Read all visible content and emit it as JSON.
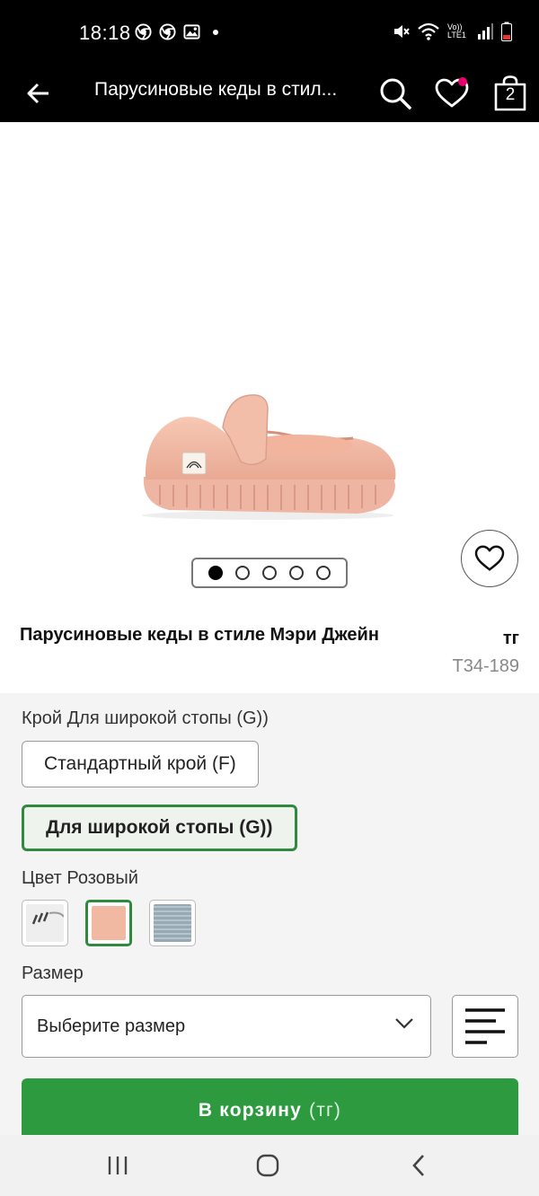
{
  "status_bar": {
    "time": "18:18",
    "left_icons": [
      "chrome-icon",
      "chrome-icon",
      "image-icon"
    ],
    "right_icons": [
      "mute-icon",
      "wifi-icon",
      "volte-icon",
      "signal-icon",
      "battery-icon"
    ],
    "volte_label": "Vo)) LTE1"
  },
  "app_bar": {
    "title": "Парусиновые кеды в стил...",
    "cart_count": "2",
    "has_favorites_badge": true
  },
  "gallery": {
    "image": "pink-canvas-mary-jane-shoe",
    "pages": 5,
    "current_page": 1
  },
  "product": {
    "name": "Парусиновые кеды в стиле Мэри Джейн",
    "price": "тг",
    "sku": "T34-189"
  },
  "fit": {
    "label": "Крой Для широкой стопы (G))",
    "options": [
      {
        "label": "Стандартный крой (F)",
        "selected": false
      },
      {
        "label": "Для широкой стопы (G))",
        "selected": true
      }
    ]
  },
  "color": {
    "label": "Цвет Розовый",
    "swatches": [
      {
        "name": "white",
        "color": "#eeeeee",
        "selected": false
      },
      {
        "name": "pink",
        "color": "#f2b9a2",
        "selected": true
      },
      {
        "name": "blue-grey",
        "color": "#97a9b3",
        "selected": false
      }
    ]
  },
  "size": {
    "label": "Размер",
    "placeholder": "Выберите размер"
  },
  "add_to_cart": {
    "label": "В корзину",
    "suffix": "(тг)",
    "color": "#2e9a3f"
  },
  "colors": {
    "accent_green": "#2f8a3f",
    "badge_pink": "#e6006e"
  }
}
